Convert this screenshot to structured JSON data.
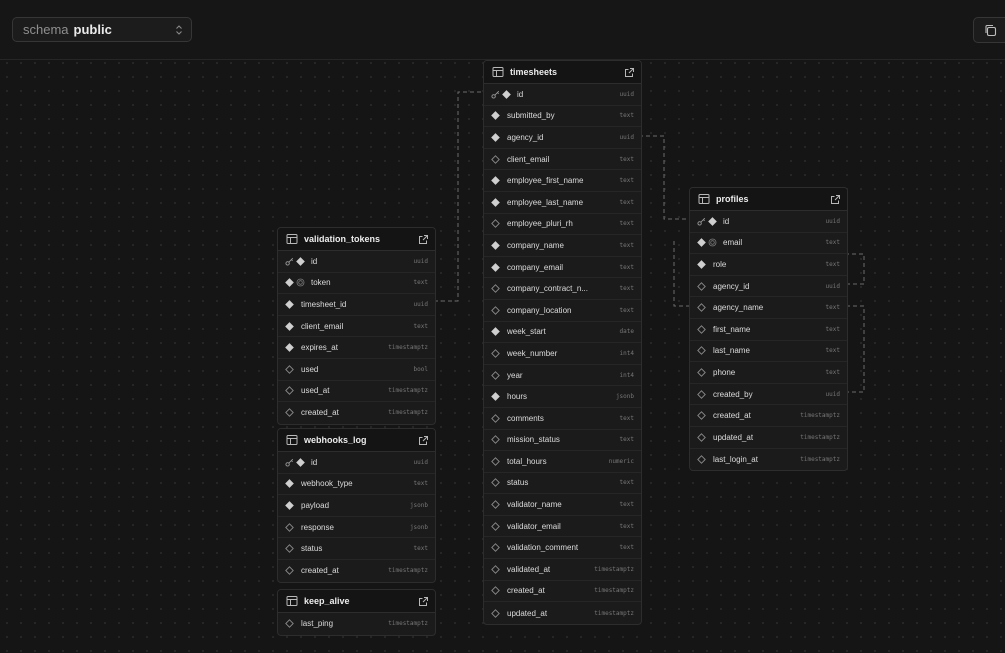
{
  "toolbar": {
    "schema_label": "schema",
    "schema_value": "public"
  },
  "tables": [
    {
      "name": "timesheets",
      "columns": [
        {
          "name": "id",
          "type": "uuid",
          "pk": true,
          "nullable": false
        },
        {
          "name": "submitted_by",
          "type": "text",
          "nullable": false
        },
        {
          "name": "agency_id",
          "type": "uuid",
          "nullable": false
        },
        {
          "name": "client_email",
          "type": "text",
          "nullable": true
        },
        {
          "name": "employee_first_name",
          "type": "text",
          "nullable": false
        },
        {
          "name": "employee_last_name",
          "type": "text",
          "nullable": false
        },
        {
          "name": "employee_pluri_rh",
          "type": "text",
          "nullable": true
        },
        {
          "name": "company_name",
          "type": "text",
          "nullable": false
        },
        {
          "name": "company_email",
          "type": "text",
          "nullable": false
        },
        {
          "name": "company_contract_n...",
          "type": "text",
          "nullable": true
        },
        {
          "name": "company_location",
          "type": "text",
          "nullable": true
        },
        {
          "name": "week_start",
          "type": "date",
          "nullable": false
        },
        {
          "name": "week_number",
          "type": "int4",
          "nullable": true
        },
        {
          "name": "year",
          "type": "int4",
          "nullable": true
        },
        {
          "name": "hours",
          "type": "jsonb",
          "nullable": false
        },
        {
          "name": "comments",
          "type": "text",
          "nullable": true
        },
        {
          "name": "mission_status",
          "type": "text",
          "nullable": true
        },
        {
          "name": "total_hours",
          "type": "numeric",
          "nullable": true
        },
        {
          "name": "status",
          "type": "text",
          "nullable": true
        },
        {
          "name": "validator_name",
          "type": "text",
          "nullable": true
        },
        {
          "name": "validator_email",
          "type": "text",
          "nullable": true
        },
        {
          "name": "validation_comment",
          "type": "text",
          "nullable": true
        },
        {
          "name": "validated_at",
          "type": "timestamptz",
          "nullable": true
        },
        {
          "name": "created_at",
          "type": "timestamptz",
          "nullable": true
        },
        {
          "name": "updated_at",
          "type": "timestamptz",
          "nullable": true
        }
      ]
    },
    {
      "name": "profiles",
      "columns": [
        {
          "name": "id",
          "type": "uuid",
          "pk": true,
          "nullable": false
        },
        {
          "name": "email",
          "type": "text",
          "unique": true,
          "nullable": false
        },
        {
          "name": "role",
          "type": "text",
          "nullable": false
        },
        {
          "name": "agency_id",
          "type": "uuid",
          "nullable": true
        },
        {
          "name": "agency_name",
          "type": "text",
          "nullable": true
        },
        {
          "name": "first_name",
          "type": "text",
          "nullable": true
        },
        {
          "name": "last_name",
          "type": "text",
          "nullable": true
        },
        {
          "name": "phone",
          "type": "text",
          "nullable": true
        },
        {
          "name": "created_by",
          "type": "uuid",
          "nullable": true
        },
        {
          "name": "created_at",
          "type": "timestamptz",
          "nullable": true
        },
        {
          "name": "updated_at",
          "type": "timestamptz",
          "nullable": true
        },
        {
          "name": "last_login_at",
          "type": "timestamptz",
          "nullable": true
        }
      ]
    },
    {
      "name": "validation_tokens",
      "columns": [
        {
          "name": "id",
          "type": "uuid",
          "pk": true,
          "nullable": false
        },
        {
          "name": "token",
          "type": "text",
          "unique": true,
          "nullable": false
        },
        {
          "name": "timesheet_id",
          "type": "uuid",
          "nullable": false
        },
        {
          "name": "client_email",
          "type": "text",
          "nullable": false
        },
        {
          "name": "expires_at",
          "type": "timestamptz",
          "nullable": false
        },
        {
          "name": "used",
          "type": "bool",
          "nullable": true
        },
        {
          "name": "used_at",
          "type": "timestamptz",
          "nullable": true
        },
        {
          "name": "created_at",
          "type": "timestamptz",
          "nullable": true
        }
      ]
    },
    {
      "name": "webhooks_log",
      "columns": [
        {
          "name": "id",
          "type": "uuid",
          "pk": true,
          "nullable": false
        },
        {
          "name": "webhook_type",
          "type": "text",
          "nullable": false
        },
        {
          "name": "payload",
          "type": "jsonb",
          "nullable": false
        },
        {
          "name": "response",
          "type": "jsonb",
          "nullable": true
        },
        {
          "name": "status",
          "type": "text",
          "nullable": true
        },
        {
          "name": "created_at",
          "type": "timestamptz",
          "nullable": true
        }
      ]
    },
    {
      "name": "keep_alive",
      "columns": [
        {
          "name": "last_ping",
          "type": "timestamptz",
          "nullable": true
        }
      ]
    }
  ]
}
